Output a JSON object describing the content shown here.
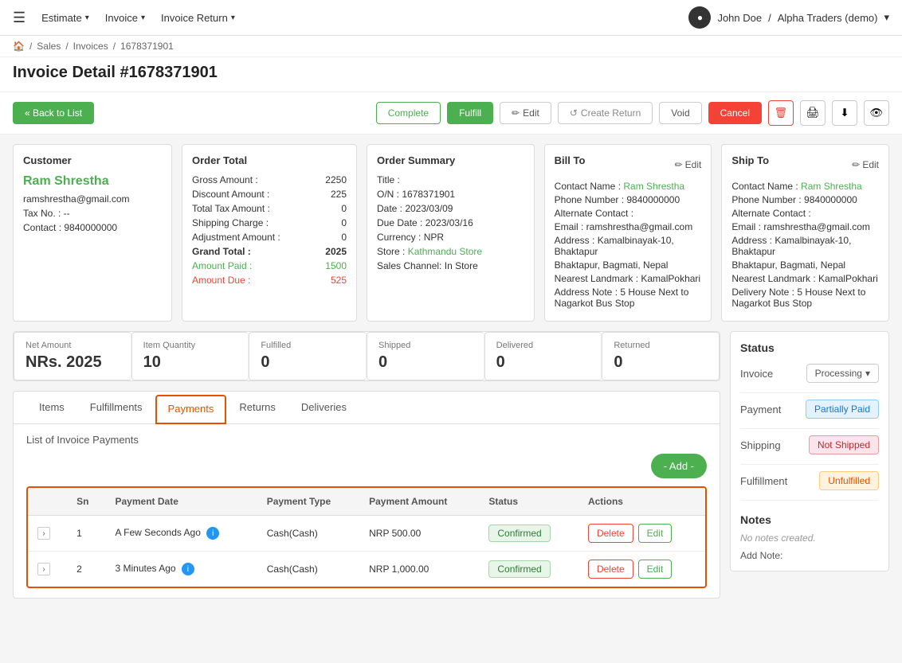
{
  "nav": {
    "hamburger": "☰",
    "items": [
      {
        "label": "Estimate",
        "id": "estimate"
      },
      {
        "label": "Invoice",
        "id": "invoice"
      },
      {
        "label": "Invoice Return",
        "id": "invoice-return"
      }
    ],
    "user": {
      "name": "John Doe",
      "company": "Alpha Traders (demo)"
    }
  },
  "breadcrumb": {
    "home": "🏠",
    "parts": [
      "Sales",
      "Invoices",
      "1678371901"
    ]
  },
  "page_title": "Invoice Detail #1678371901",
  "actions": {
    "back_label": "« Back to List",
    "complete": "Complete",
    "fulfill": "Fulfill",
    "edit": "Edit",
    "create_return": "Create Return",
    "void": "Void",
    "cancel": "Cancel"
  },
  "customer": {
    "header": "Customer",
    "name": "Ram Shrestha",
    "email": "ramshrestha@gmail.com",
    "tax": "Tax No. : --",
    "contact": "Contact : 9840000000"
  },
  "order_total": {
    "header": "Order Total",
    "rows": [
      {
        "label": "Gross Amount :",
        "value": "2250",
        "style": "normal"
      },
      {
        "label": "Discount Amount :",
        "value": "225",
        "style": "normal"
      },
      {
        "label": "Total Tax Amount :",
        "value": "0",
        "style": "normal"
      },
      {
        "label": "Shipping Charge :",
        "value": "0",
        "style": "normal"
      },
      {
        "label": "Adjustment Amount :",
        "value": "0",
        "style": "normal"
      },
      {
        "label": "Grand Total :",
        "value": "2025",
        "style": "bold"
      },
      {
        "label": "Amount Paid :",
        "value": "1500",
        "style": "green"
      },
      {
        "label": "Amount Due :",
        "value": "525",
        "style": "red"
      }
    ]
  },
  "order_summary": {
    "header": "Order Summary",
    "rows": [
      {
        "label": "Title :",
        "value": ""
      },
      {
        "label": "O/N :",
        "value": "1678371901"
      },
      {
        "label": "Date :",
        "value": "2023/03/09"
      },
      {
        "label": "Due Date :",
        "value": "2023/03/16"
      },
      {
        "label": "Currency :",
        "value": "NPR"
      },
      {
        "label": "Store :",
        "value": "Kathmandu Store",
        "green": true
      },
      {
        "label": "Sales Channel:",
        "value": "In Store"
      }
    ]
  },
  "bill_to": {
    "header": "Bill To",
    "edit_label": "Edit",
    "rows": [
      {
        "label": "Contact Name : ",
        "value": "Ram Shrestha",
        "green": true
      },
      {
        "label": "Phone Number : ",
        "value": "9840000000"
      },
      {
        "label": "Alternate Contact : ",
        "value": ""
      },
      {
        "label": "Email : ",
        "value": "ramshrestha@gmail.com"
      },
      {
        "label": "Address : ",
        "value": "Kamalbinayak-10, Bhaktapur"
      },
      {
        "label": "",
        "value": "Bhaktapur, Bagmati, Nepal"
      },
      {
        "label": "Nearest Landmark : ",
        "value": "KamalPokhari"
      },
      {
        "label": "Address Note : ",
        "value": "5 House Next to Nagarkot Bus Stop"
      }
    ]
  },
  "ship_to": {
    "header": "Ship To",
    "edit_label": "Edit",
    "rows": [
      {
        "label": "Contact Name : ",
        "value": "Ram Shrestha",
        "green": true
      },
      {
        "label": "Phone Number : ",
        "value": "9840000000"
      },
      {
        "label": "Alternate Contact : ",
        "value": ""
      },
      {
        "label": "Email : ",
        "value": "ramshrestha@gmail.com"
      },
      {
        "label": "Address : ",
        "value": "Kamalbinayak-10, Bhaktapur"
      },
      {
        "label": "",
        "value": "Bhaktapur, Bagmati, Nepal"
      },
      {
        "label": "Nearest Landmark : ",
        "value": "KamalPokhari"
      },
      {
        "label": "Delivery Note : ",
        "value": "5 House Next to Nagarkot Bus Stop"
      }
    ]
  },
  "stats": {
    "net_amount": {
      "label": "Net Amount",
      "value": "NRs. 2025"
    },
    "item_quantity": {
      "label": "Item Quantity",
      "value": "10"
    },
    "fulfilled": {
      "label": "Fulfilled",
      "value": "0"
    },
    "shipped": {
      "label": "Shipped",
      "value": "0"
    },
    "delivered": {
      "label": "Delivered",
      "value": "0"
    },
    "returned": {
      "label": "Returned",
      "value": "0"
    }
  },
  "status_panel": {
    "header": "Status",
    "invoice": {
      "label": "Invoice",
      "value": "Processing"
    },
    "payment": {
      "label": "Payment",
      "value": "Partially Paid"
    },
    "shipping": {
      "label": "Shipping",
      "value": "Not Shipped"
    },
    "fulfillment": {
      "label": "Fulfillment",
      "value": "Unfulfilled"
    }
  },
  "notes": {
    "header": "Notes",
    "empty_text": "No notes created.",
    "add_label": "Add Note:"
  },
  "tabs": {
    "items": [
      {
        "label": "Items",
        "id": "items"
      },
      {
        "label": "Fulfillments",
        "id": "fulfillments"
      },
      {
        "label": "Payments",
        "id": "payments",
        "active": true
      },
      {
        "label": "Returns",
        "id": "returns"
      },
      {
        "label": "Deliveries",
        "id": "deliveries"
      }
    ]
  },
  "payments_section": {
    "title": "List of Invoice Payments",
    "add_btn": "- Add -",
    "table": {
      "headers": [
        "",
        "Sn",
        "Payment Date",
        "Payment Type",
        "Payment Amount",
        "Status",
        "Actions"
      ],
      "rows": [
        {
          "sn": "1",
          "date": "A Few Seconds Ago",
          "type": "Cash(Cash)",
          "amount": "NRP 500.00",
          "status": "Confirmed",
          "delete_btn": "Delete",
          "edit_btn": "Edit"
        },
        {
          "sn": "2",
          "date": "3 Minutes Ago",
          "type": "Cash(Cash)",
          "amount": "NRP 1,000.00",
          "status": "Confirmed",
          "delete_btn": "Delete",
          "edit_btn": "Edit"
        }
      ]
    }
  }
}
